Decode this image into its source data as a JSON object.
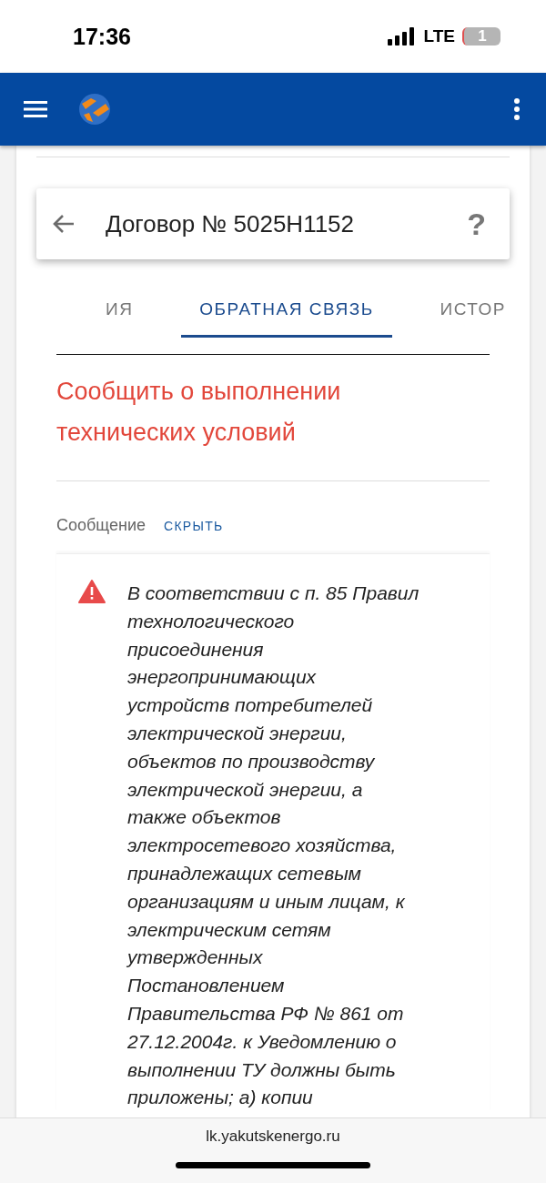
{
  "status_bar": {
    "time": "17:36",
    "network": "LTE",
    "battery": "1"
  },
  "card": {
    "title": "Договор № 5025Н1152",
    "help": "?"
  },
  "tabs": [
    {
      "label": "ИЯ",
      "selected": false
    },
    {
      "label": "ОБРАТНАЯ СВЯЗЬ",
      "selected": true
    },
    {
      "label": "ИСТОР",
      "selected": false
    }
  ],
  "heading": "Сообщить о выполнении технических условий",
  "message": {
    "label": "Сообщение",
    "toggle": "СКРЫТЬ",
    "lines": [
      "В соответствии с п. 85 Правил",
      "технологического",
      "присоединения",
      "энергопринимающих",
      "устройств потребителей",
      "электрической энергии,",
      "объектов по производству",
      "электрической энергии, а",
      "также объектов",
      "электросетевого хозяйства,",
      "принадлежащих сетевым",
      "организациям и иным лицам, к",
      "электрическим сетям",
      "утвержденных",
      "Постановлением",
      "Правительства РФ № 861 от",
      "27.12.2004г. к Уведомлению о",
      "выполнении ТУ должны быть",
      "приложены; а) копии"
    ]
  },
  "browser": {
    "url": "lk.yakutskenergo.ru"
  }
}
